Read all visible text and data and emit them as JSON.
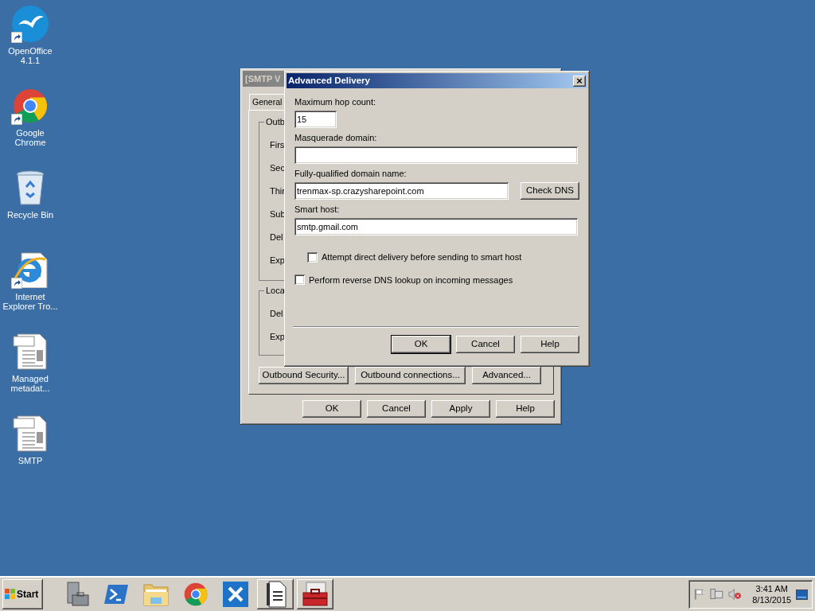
{
  "desktop_icons": [
    {
      "label": "OpenOffice 4.1.1",
      "kind": "openoffice",
      "shortcut": true
    },
    {
      "label": "Google Chrome",
      "kind": "chrome",
      "shortcut": true
    },
    {
      "label": "Recycle Bin",
      "kind": "recycle",
      "shortcut": false
    },
    {
      "label": "Internet Explorer Tro...",
      "kind": "ie",
      "shortcut": true
    },
    {
      "label": "Managed metadat...",
      "kind": "document",
      "shortcut": false
    },
    {
      "label": "SMTP",
      "kind": "document",
      "shortcut": false
    }
  ],
  "back_window": {
    "title": "[SMTP V",
    "active": false,
    "tab": {
      "label": "General",
      "selected": true
    },
    "groups": [
      {
        "title": "Outb",
        "labels": [
          "Firs",
          "Sec",
          "Thir",
          "Sub",
          "Del",
          "Exp"
        ]
      },
      {
        "title": "Loca",
        "labels": [
          "Del",
          "Exp"
        ]
      }
    ],
    "action_buttons": [
      "Outbound Security...",
      "Outbound connections...",
      "Advanced..."
    ],
    "buttons": [
      {
        "label": "OK",
        "default": false
      },
      {
        "label": "Cancel",
        "default": false
      },
      {
        "label": "Apply",
        "default": false
      },
      {
        "label": "Help",
        "default": false
      }
    ]
  },
  "dialog": {
    "title": "Advanced Delivery",
    "active": true,
    "close": "×",
    "fields": [
      {
        "label": "Maximum hop count:",
        "value": "15",
        "kind": "short"
      },
      {
        "label": "Masquerade domain:",
        "kind": "wide"
      },
      {
        "label": "Fully-qualified domain name:",
        "value": "trenmax-sp.crazysharepoint.com",
        "kind": "with_button",
        "button": "Check DNS"
      },
      {
        "label": "Smart host:",
        "value": "smtp.gmail.com",
        "kind": "wide",
        "children": [
          {
            "label": "Attempt direct delivery before sending to smart host",
            "checked": false
          }
        ]
      }
    ],
    "checkboxes": [
      {
        "label": "Perform reverse DNS lookup on incoming messages",
        "checked": false
      }
    ],
    "buttons": [
      {
        "label": "OK",
        "default": true
      },
      {
        "label": "Cancel",
        "default": false
      },
      {
        "label": "Help",
        "default": false
      }
    ]
  },
  "taskbar": {
    "start": "Start",
    "apps": [
      {
        "kind": "server",
        "open": false
      },
      {
        "kind": "powershell",
        "open": false
      },
      {
        "kind": "folder",
        "open": false
      },
      {
        "kind": "chrome",
        "open": false
      },
      {
        "kind": "tools",
        "open": false
      },
      {
        "kind": "document",
        "open": true
      },
      {
        "kind": "toolbox",
        "open": true
      }
    ],
    "time": "3:41 AM",
    "date": "8/13/2015"
  }
}
